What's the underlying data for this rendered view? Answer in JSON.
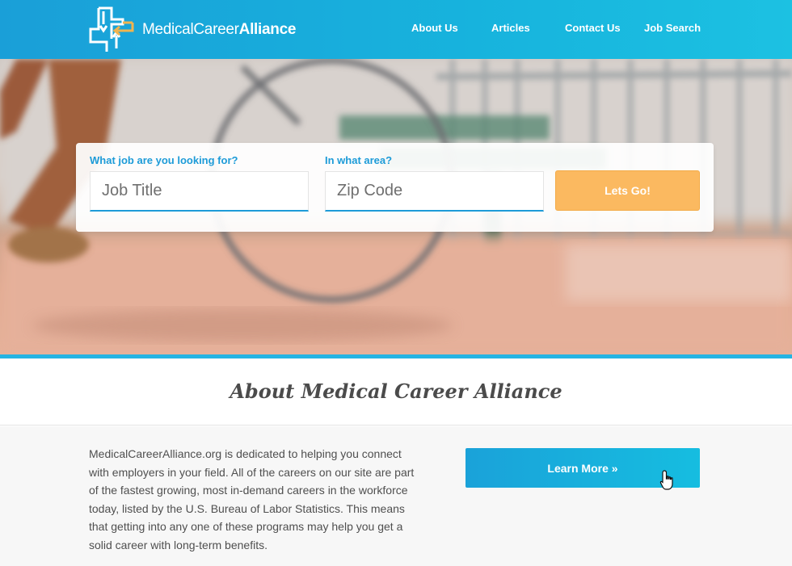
{
  "brand": {
    "name_light": "Medical",
    "name_mid": "Career",
    "name_bold": "Alliance",
    "colors": {
      "primary": "#1d9bd8",
      "accent": "#fbb960",
      "logo_arrow": "#f0b450"
    }
  },
  "nav": {
    "items": [
      {
        "label": "About Us"
      },
      {
        "label": "Articles"
      },
      {
        "label": "Contact Us"
      },
      {
        "label": "Job Search"
      }
    ]
  },
  "search": {
    "job_label": "What job are you looking for?",
    "job_placeholder": "Job Title",
    "area_label": "In what area?",
    "area_placeholder": "Zip Code",
    "submit_label": "Lets Go!"
  },
  "about": {
    "heading": "About Medical Career Alliance",
    "lines": [
      "MedicalCareerAlliance.org is dedicated to helping you connect",
      "with employers in your field. All of the careers on our site are part",
      "of the fastest growing, most in-demand careers in the workforce",
      "today, listed by the U.S. Bureau of Labor Statistics. This means",
      "that getting into any one of these programs may help you get a",
      "solid career with long-term benefits."
    ],
    "learn_more_label": "Learn More »"
  },
  "icons": {
    "logo": "medical-cross-arrows-icon",
    "cursor": "hand-pointer-icon"
  }
}
